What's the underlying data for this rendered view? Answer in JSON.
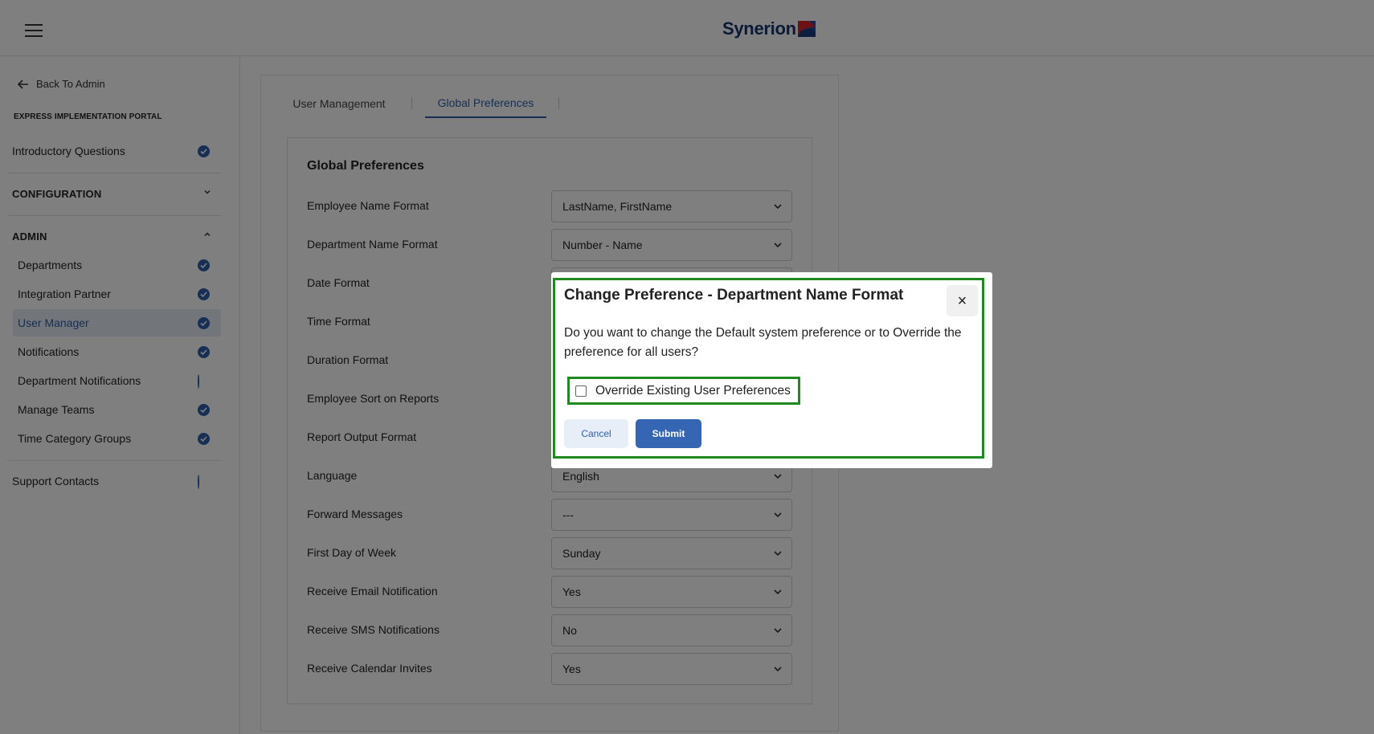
{
  "header": {
    "brand_name": "Synerion",
    "brand_colors": {
      "text": "#17356e",
      "red": "#d9252f",
      "blue": "#1f4f9a"
    }
  },
  "sidebar": {
    "back_label": "Back To Admin",
    "portal_title": "EXPRESS IMPLEMENTATION PORTAL",
    "intro": {
      "label": "Introductory Questions",
      "status": "complete"
    },
    "configuration": {
      "label": "CONFIGURATION",
      "expanded": false
    },
    "admin": {
      "label": "ADMIN",
      "expanded": true,
      "items": [
        {
          "label": "Departments",
          "status": "complete"
        },
        {
          "label": "Integration Partner",
          "status": "complete"
        },
        {
          "label": "User Manager",
          "status": "complete",
          "active": true
        },
        {
          "label": "Notifications",
          "status": "complete"
        },
        {
          "label": "Department Notifications",
          "status": "incomplete"
        },
        {
          "label": "Manage Teams",
          "status": "complete"
        },
        {
          "label": "Time Category Groups",
          "status": "complete"
        }
      ]
    },
    "support": {
      "label": "Support Contacts",
      "status": "incomplete"
    }
  },
  "tabs": [
    {
      "label": "User Management",
      "active": false
    },
    {
      "label": "Global Preferences",
      "active": true
    }
  ],
  "preferences": {
    "title": "Global Preferences",
    "rows": [
      {
        "label": "Employee Name Format",
        "value": "LastName, FirstName"
      },
      {
        "label": "Department Name Format",
        "value": "Number - Name"
      },
      {
        "label": "Date Format",
        "value": ""
      },
      {
        "label": "Time Format",
        "value": ""
      },
      {
        "label": "Duration Format",
        "value": ""
      },
      {
        "label": "Employee Sort on Reports",
        "value": ""
      },
      {
        "label": "Report Output Format",
        "value": ""
      },
      {
        "label": "Language",
        "value": "English"
      },
      {
        "label": "Forward Messages",
        "value": "---"
      },
      {
        "label": "First Day of Week",
        "value": "Sunday"
      },
      {
        "label": "Receive Email Notification",
        "value": "Yes"
      },
      {
        "label": "Receive SMS Notifications",
        "value": "No"
      },
      {
        "label": "Receive Calendar Invites",
        "value": "Yes"
      }
    ]
  },
  "dialog": {
    "title": "Change Preference - Department Name Format",
    "close_glyph": "×",
    "message": "Do you want to change the Default system preference or to Override the preference for all users?",
    "checkbox_label": "Override Existing User Preferences",
    "checkbox_checked": false,
    "cancel_label": "Cancel",
    "submit_label": "Submit"
  },
  "colors": {
    "accent": "#2e5ea8",
    "highlight": "#1f8a1f",
    "overlay": "rgba(0,0,0,0.5)"
  }
}
